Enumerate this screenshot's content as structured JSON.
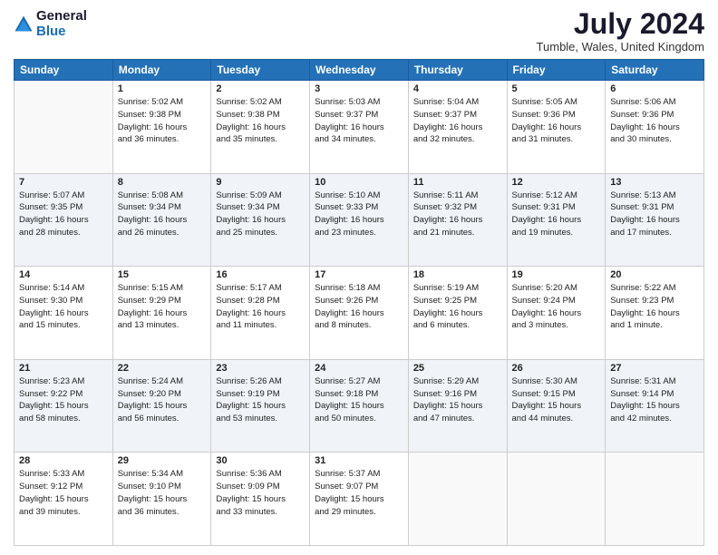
{
  "header": {
    "logo_general": "General",
    "logo_blue": "Blue",
    "month_title": "July 2024",
    "location": "Tumble, Wales, United Kingdom"
  },
  "days_of_week": [
    "Sunday",
    "Monday",
    "Tuesday",
    "Wednesday",
    "Thursday",
    "Friday",
    "Saturday"
  ],
  "weeks": [
    [
      {
        "day": "",
        "info": ""
      },
      {
        "day": "1",
        "info": "Sunrise: 5:02 AM\nSunset: 9:38 PM\nDaylight: 16 hours\nand 36 minutes."
      },
      {
        "day": "2",
        "info": "Sunrise: 5:02 AM\nSunset: 9:38 PM\nDaylight: 16 hours\nand 35 minutes."
      },
      {
        "day": "3",
        "info": "Sunrise: 5:03 AM\nSunset: 9:37 PM\nDaylight: 16 hours\nand 34 minutes."
      },
      {
        "day": "4",
        "info": "Sunrise: 5:04 AM\nSunset: 9:37 PM\nDaylight: 16 hours\nand 32 minutes."
      },
      {
        "day": "5",
        "info": "Sunrise: 5:05 AM\nSunset: 9:36 PM\nDaylight: 16 hours\nand 31 minutes."
      },
      {
        "day": "6",
        "info": "Sunrise: 5:06 AM\nSunset: 9:36 PM\nDaylight: 16 hours\nand 30 minutes."
      }
    ],
    [
      {
        "day": "7",
        "info": "Sunrise: 5:07 AM\nSunset: 9:35 PM\nDaylight: 16 hours\nand 28 minutes."
      },
      {
        "day": "8",
        "info": "Sunrise: 5:08 AM\nSunset: 9:34 PM\nDaylight: 16 hours\nand 26 minutes."
      },
      {
        "day": "9",
        "info": "Sunrise: 5:09 AM\nSunset: 9:34 PM\nDaylight: 16 hours\nand 25 minutes."
      },
      {
        "day": "10",
        "info": "Sunrise: 5:10 AM\nSunset: 9:33 PM\nDaylight: 16 hours\nand 23 minutes."
      },
      {
        "day": "11",
        "info": "Sunrise: 5:11 AM\nSunset: 9:32 PM\nDaylight: 16 hours\nand 21 minutes."
      },
      {
        "day": "12",
        "info": "Sunrise: 5:12 AM\nSunset: 9:31 PM\nDaylight: 16 hours\nand 19 minutes."
      },
      {
        "day": "13",
        "info": "Sunrise: 5:13 AM\nSunset: 9:31 PM\nDaylight: 16 hours\nand 17 minutes."
      }
    ],
    [
      {
        "day": "14",
        "info": "Sunrise: 5:14 AM\nSunset: 9:30 PM\nDaylight: 16 hours\nand 15 minutes."
      },
      {
        "day": "15",
        "info": "Sunrise: 5:15 AM\nSunset: 9:29 PM\nDaylight: 16 hours\nand 13 minutes."
      },
      {
        "day": "16",
        "info": "Sunrise: 5:17 AM\nSunset: 9:28 PM\nDaylight: 16 hours\nand 11 minutes."
      },
      {
        "day": "17",
        "info": "Sunrise: 5:18 AM\nSunset: 9:26 PM\nDaylight: 16 hours\nand 8 minutes."
      },
      {
        "day": "18",
        "info": "Sunrise: 5:19 AM\nSunset: 9:25 PM\nDaylight: 16 hours\nand 6 minutes."
      },
      {
        "day": "19",
        "info": "Sunrise: 5:20 AM\nSunset: 9:24 PM\nDaylight: 16 hours\nand 3 minutes."
      },
      {
        "day": "20",
        "info": "Sunrise: 5:22 AM\nSunset: 9:23 PM\nDaylight: 16 hours\nand 1 minute."
      }
    ],
    [
      {
        "day": "21",
        "info": "Sunrise: 5:23 AM\nSunset: 9:22 PM\nDaylight: 15 hours\nand 58 minutes."
      },
      {
        "day": "22",
        "info": "Sunrise: 5:24 AM\nSunset: 9:20 PM\nDaylight: 15 hours\nand 56 minutes."
      },
      {
        "day": "23",
        "info": "Sunrise: 5:26 AM\nSunset: 9:19 PM\nDaylight: 15 hours\nand 53 minutes."
      },
      {
        "day": "24",
        "info": "Sunrise: 5:27 AM\nSunset: 9:18 PM\nDaylight: 15 hours\nand 50 minutes."
      },
      {
        "day": "25",
        "info": "Sunrise: 5:29 AM\nSunset: 9:16 PM\nDaylight: 15 hours\nand 47 minutes."
      },
      {
        "day": "26",
        "info": "Sunrise: 5:30 AM\nSunset: 9:15 PM\nDaylight: 15 hours\nand 44 minutes."
      },
      {
        "day": "27",
        "info": "Sunrise: 5:31 AM\nSunset: 9:14 PM\nDaylight: 15 hours\nand 42 minutes."
      }
    ],
    [
      {
        "day": "28",
        "info": "Sunrise: 5:33 AM\nSunset: 9:12 PM\nDaylight: 15 hours\nand 39 minutes."
      },
      {
        "day": "29",
        "info": "Sunrise: 5:34 AM\nSunset: 9:10 PM\nDaylight: 15 hours\nand 36 minutes."
      },
      {
        "day": "30",
        "info": "Sunrise: 5:36 AM\nSunset: 9:09 PM\nDaylight: 15 hours\nand 33 minutes."
      },
      {
        "day": "31",
        "info": "Sunrise: 5:37 AM\nSunset: 9:07 PM\nDaylight: 15 hours\nand 29 minutes."
      },
      {
        "day": "",
        "info": ""
      },
      {
        "day": "",
        "info": ""
      },
      {
        "day": "",
        "info": ""
      }
    ]
  ]
}
